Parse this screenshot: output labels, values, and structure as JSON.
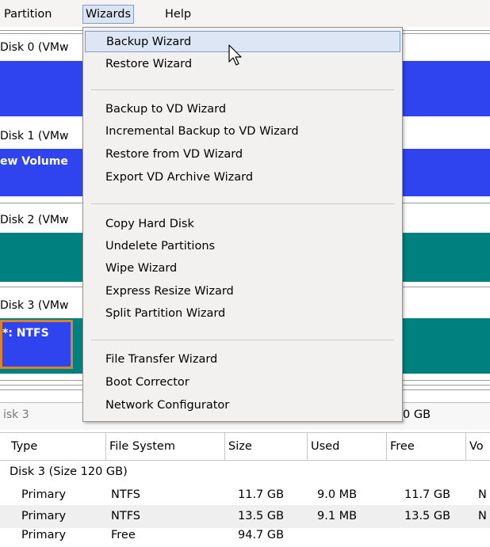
{
  "menubar": {
    "partition": "Partition",
    "wizards": "Wizards",
    "help": "Help"
  },
  "disks": [
    {
      "label": "Disk 0 (VMw"
    },
    {
      "label": "Disk 1 (VMw",
      "volume": "ew Volume"
    },
    {
      "label": "Disk 2 (VMw"
    },
    {
      "label": "Disk 3 (VMw",
      "volume": "*: NTFS"
    }
  ],
  "info_row": {
    "left": "isk 3",
    "right": "0 GB"
  },
  "table": {
    "headers": [
      "Type",
      "File System",
      "Size",
      "Used",
      "Free",
      "Vo"
    ],
    "group": "Disk 3 (Size 120 GB)",
    "rows": [
      {
        "type": "Primary",
        "fs": "NTFS",
        "size": "11.7 GB",
        "used": "9.0 MB",
        "free": "11.7 GB",
        "vol": "N"
      },
      {
        "type": "Primary",
        "fs": "NTFS",
        "size": "13.5 GB",
        "used": "9.1 MB",
        "free": "13.5 GB",
        "vol": "N"
      },
      {
        "type": "Primary",
        "fs": "Free",
        "size": "94.7 GB",
        "used": "",
        "free": "",
        "vol": ""
      }
    ]
  },
  "wizards_menu": {
    "items": [
      "Backup Wizard",
      "Restore Wizard",
      "Backup to VD Wizard",
      "Incremental Backup to VD Wizard",
      "Restore from VD Wizard",
      "Export VD Archive Wizard",
      "Copy Hard Disk",
      "Undelete Partitions",
      "Wipe Wizard",
      "Express Resize Wizard",
      "Split Partition Wizard",
      "File Transfer Wizard",
      "Boot Corrector",
      "Network Configurator"
    ]
  },
  "colors": {
    "blue_partition": "#2f43ef",
    "teal_partition": "#00807f",
    "selection_border": "#d9822b",
    "menu_highlight": "#dde6f4"
  }
}
